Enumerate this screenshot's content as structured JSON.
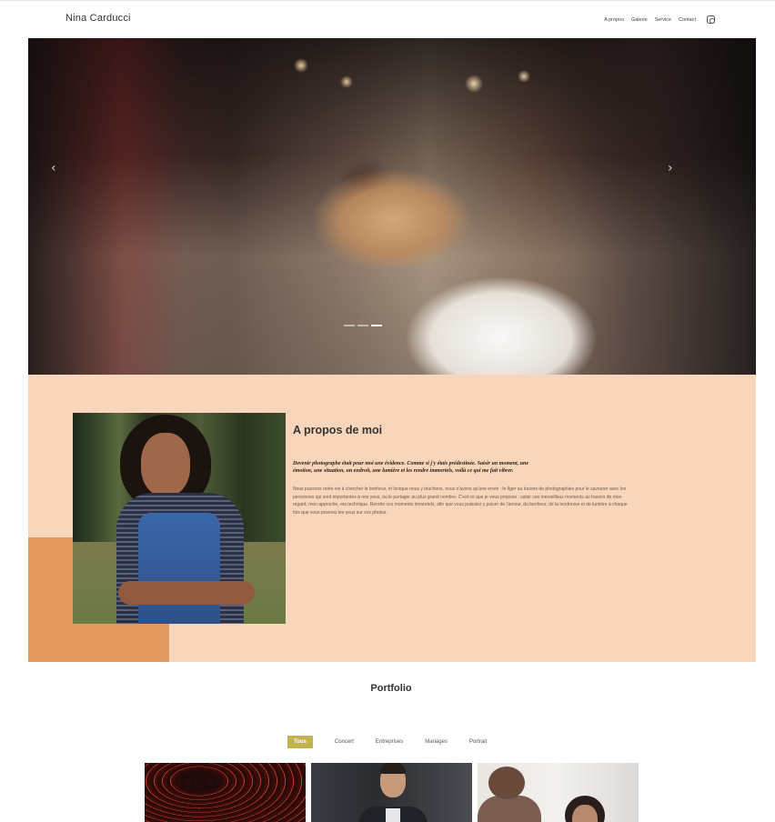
{
  "header": {
    "brand": "Nina Carducci",
    "nav": {
      "about": "A propos",
      "gallery": "Galerie",
      "service": "Service",
      "contact": "Contact"
    },
    "social_icon": "instagram-icon"
  },
  "hero": {
    "prev_icon": "chevron-left-icon",
    "next_icon": "chevron-right-icon",
    "prev_glyph": "‹",
    "next_glyph": "›",
    "slide_count": 3,
    "active_slide": 3
  },
  "about": {
    "title": "A propos de moi",
    "lead": "Devenir photographe était pour moi une évidence. Comme si j'y étais prédestinée. Saisir un moment, une émotion, une situation, un endroit, une lumière et les rendre immortels, voilà ce qui me fait vibrer.",
    "body": "Nous passons notre vie à chercher le bonheur, et lorsque nous y touchons, nous n'avons qu'une envie : le figer au travers de photographies pour le savourer avec les personnes qui sont importantes à nos yeux, ou le partager au plus grand nombre. C'est ce que je vous propose : saisir ces merveilleux moments au travers de mon regard, mon approche, ma technique. Rendre ces moments immortels, afin que vous puissiez y puiser de l'amour, du bonheur, de la tendresse et de lumière à chaque fois que vous poserez les yeux sur vos photos.",
    "accent_color": "#e4995e",
    "background_color": "#f8d6bb"
  },
  "portfolio": {
    "title": "Portfolio",
    "filters": [
      "Tous",
      "Concert",
      "Entreprises",
      "Mariages",
      "Portrait"
    ],
    "active_filter": "Tous",
    "active_filter_color": "#c1b44f"
  }
}
